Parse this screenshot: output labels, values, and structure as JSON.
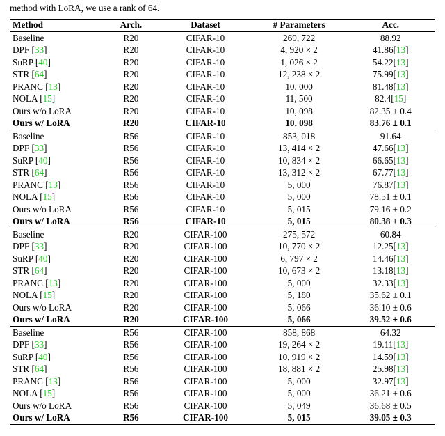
{
  "caption_fragment": "method with LoRA, we use a rank of 64.",
  "headers": {
    "method": "Method",
    "arch": "Arch.",
    "dataset": "Dataset",
    "params": "# Parameters",
    "acc": "Acc."
  },
  "ref_open": "[",
  "ref_close": "]",
  "chart_data": {
    "type": "table",
    "groups": [
      {
        "rows": [
          {
            "method": "Baseline",
            "ref": null,
            "arch": "R20",
            "dataset": "CIFAR-10",
            "params": "269, 722",
            "acc": "88.92",
            "acc_ref": null,
            "bold": false
          },
          {
            "method": "DPF",
            "ref": "33",
            "arch": "R20",
            "dataset": "CIFAR-10",
            "params": "4, 920 × 2",
            "acc": "41.86",
            "acc_ref": "13",
            "bold": false
          },
          {
            "method": "SuRP",
            "ref": "40",
            "arch": "R20",
            "dataset": "CIFAR-10",
            "params": "1, 026 × 2",
            "acc": "54.22",
            "acc_ref": "13",
            "bold": false
          },
          {
            "method": "STR",
            "ref": "64",
            "arch": "R20",
            "dataset": "CIFAR-10",
            "params": "12, 238 × 2",
            "acc": "75.99",
            "acc_ref": "13",
            "bold": false
          },
          {
            "method": "PRANC",
            "ref": "13",
            "arch": "R20",
            "dataset": "CIFAR-10",
            "params": "10, 000",
            "acc": "81.48",
            "acc_ref": "13",
            "bold": false
          },
          {
            "method": "NOLA",
            "ref": "15",
            "arch": "R20",
            "dataset": "CIFAR-10",
            "params": "11, 500",
            "acc": "82.4",
            "acc_ref": "15",
            "bold": false
          },
          {
            "method": "Ours w/o LoRA",
            "ref": null,
            "arch": "R20",
            "dataset": "CIFAR-10",
            "params": "10, 098",
            "acc": "82.35 ± 0.4",
            "acc_ref": null,
            "bold": false
          },
          {
            "method": "Ours w/ LoRA",
            "ref": null,
            "arch": "R20",
            "dataset": "CIFAR-10",
            "params": "10, 098",
            "acc": "83.76 ± 0.1",
            "acc_ref": null,
            "bold": true
          }
        ]
      },
      {
        "rows": [
          {
            "method": "Baseline",
            "ref": null,
            "arch": "R56",
            "dataset": "CIFAR-10",
            "params": "853, 018",
            "acc": "91.64",
            "acc_ref": null,
            "bold": false
          },
          {
            "method": "DPF",
            "ref": "33",
            "arch": "R56",
            "dataset": "CIFAR-10",
            "params": "13, 414 × 2",
            "acc": "47.66",
            "acc_ref": "13",
            "bold": false
          },
          {
            "method": "SuRP",
            "ref": "40",
            "arch": "R56",
            "dataset": "CIFAR-10",
            "params": "10, 834 × 2",
            "acc": "66.65",
            "acc_ref": "13",
            "bold": false
          },
          {
            "method": "STR",
            "ref": "64",
            "arch": "R56",
            "dataset": "CIFAR-10",
            "params": "13, 312 × 2",
            "acc": "67.77",
            "acc_ref": "13",
            "bold": false
          },
          {
            "method": "PRANC",
            "ref": "13",
            "arch": "R56",
            "dataset": "CIFAR-10",
            "params": "5, 000",
            "acc": "76.87",
            "acc_ref": "13",
            "bold": false
          },
          {
            "method": "NOLA",
            "ref": "15",
            "arch": "R56",
            "dataset": "CIFAR-10",
            "params": "5, 000",
            "acc": "78.51 ± 0.1",
            "acc_ref": null,
            "bold": false
          },
          {
            "method": "Ours w/o LoRA",
            "ref": null,
            "arch": "R56",
            "dataset": "CIFAR-10",
            "params": "5, 015",
            "acc": "79.16 ± 0.2",
            "acc_ref": null,
            "bold": false
          },
          {
            "method": "Ours w/ LoRA",
            "ref": null,
            "arch": "R56",
            "dataset": "CIFAR-10",
            "params": "5, 015",
            "acc": "80.38 ± 0.3",
            "acc_ref": null,
            "bold": true
          }
        ]
      },
      {
        "rows": [
          {
            "method": "Baseline",
            "ref": null,
            "arch": "R20",
            "dataset": "CIFAR-100",
            "params": "275, 572",
            "acc": "60.84",
            "acc_ref": null,
            "bold": false
          },
          {
            "method": "DPF",
            "ref": "33",
            "arch": "R20",
            "dataset": "CIFAR-100",
            "params": "10, 770 × 2",
            "acc": "12.25",
            "acc_ref": "13",
            "bold": false
          },
          {
            "method": "SuRP",
            "ref": "40",
            "arch": "R20",
            "dataset": "CIFAR-100",
            "params": "6, 797 × 2",
            "acc": "14.46",
            "acc_ref": "13",
            "bold": false
          },
          {
            "method": "STR",
            "ref": "64",
            "arch": "R20",
            "dataset": "CIFAR-100",
            "params": "10, 673 × 2",
            "acc": "13.18",
            "acc_ref": "13",
            "bold": false
          },
          {
            "method": "PRANC",
            "ref": "13",
            "arch": "R20",
            "dataset": "CIFAR-100",
            "params": "5, 000",
            "acc": "32.33",
            "acc_ref": "13",
            "bold": false
          },
          {
            "method": "NOLA",
            "ref": "15",
            "arch": "R20",
            "dataset": "CIFAR-100",
            "params": "5, 180",
            "acc": "35.62 ± 0.1",
            "acc_ref": null,
            "bold": false
          },
          {
            "method": "Ours w/o LoRA",
            "ref": null,
            "arch": "R20",
            "dataset": "CIFAR-100",
            "params": "5, 066",
            "acc": "36.10 ± 0.6",
            "acc_ref": null,
            "bold": false
          },
          {
            "method": "Ours w/ LoRA",
            "ref": null,
            "arch": "R20",
            "dataset": "CIFAR-100",
            "params": "5, 066",
            "acc": "39.52 ± 0.6",
            "acc_ref": null,
            "bold": true
          }
        ]
      },
      {
        "rows": [
          {
            "method": "Baseline",
            "ref": null,
            "arch": "R56",
            "dataset": "CIFAR-100",
            "params": "858, 868",
            "acc": "64.32",
            "acc_ref": null,
            "bold": false
          },
          {
            "method": "DPF",
            "ref": "33",
            "arch": "R56",
            "dataset": "CIFAR-100",
            "params": "19, 264 × 2",
            "acc": "19.11",
            "acc_ref": "13",
            "bold": false
          },
          {
            "method": "SuRP",
            "ref": "40",
            "arch": "R56",
            "dataset": "CIFAR-100",
            "params": "10, 919 × 2",
            "acc": "14.59",
            "acc_ref": "13",
            "bold": false
          },
          {
            "method": "STR",
            "ref": "64",
            "arch": "R56",
            "dataset": "CIFAR-100",
            "params": "18, 881 × 2",
            "acc": "25.98",
            "acc_ref": "13",
            "bold": false
          },
          {
            "method": "PRANC",
            "ref": "13",
            "arch": "R56",
            "dataset": "CIFAR-100",
            "params": "5, 000",
            "acc": "32.97",
            "acc_ref": "13",
            "bold": false
          },
          {
            "method": "NOLA",
            "ref": "15",
            "arch": "R56",
            "dataset": "CIFAR-100",
            "params": "5, 000",
            "acc": "36.21 ± 0.6",
            "acc_ref": null,
            "bold": false
          },
          {
            "method": "Ours w/o LoRA",
            "ref": null,
            "arch": "R56",
            "dataset": "CIFAR-100",
            "params": "5, 049",
            "acc": "36.68 ± 0.5",
            "acc_ref": null,
            "bold": false
          },
          {
            "method": "Ours w/ LoRA",
            "ref": null,
            "arch": "R56",
            "dataset": "CIFAR-100",
            "params": "5, 015",
            "acc": "39.05 ± 0.3",
            "acc_ref": null,
            "bold": true
          }
        ]
      }
    ]
  }
}
